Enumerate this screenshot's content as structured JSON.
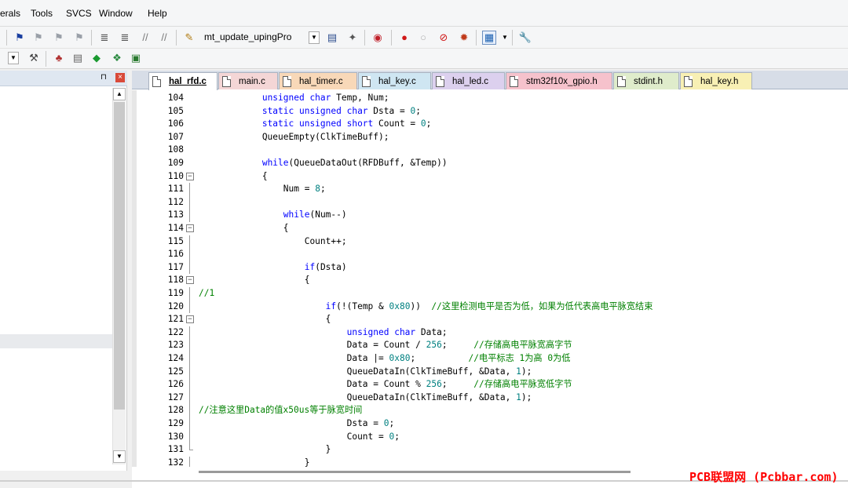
{
  "menu": [
    "erals",
    "Tools",
    "SVCS",
    "Window",
    "Help"
  ],
  "toolbar": {
    "target_name": "mt_update_upingPro"
  },
  "tabs": [
    {
      "label": "hal_rfd.c",
      "color": "#ffffff",
      "active": true
    },
    {
      "label": "main.c",
      "color": "#f4d6d6"
    },
    {
      "label": "hal_timer.c",
      "color": "#f8d8b8"
    },
    {
      "label": "hal_key.c",
      "color": "#cfe6f2"
    },
    {
      "label": "hal_led.c",
      "color": "#dcd0ee"
    },
    {
      "label": "stm32f10x_gpio.h",
      "color": "#f6c2cc"
    },
    {
      "label": "stdint.h",
      "color": "#dfeccb"
    },
    {
      "label": "hal_key.h",
      "color": "#f8f0b4"
    }
  ],
  "code_lines": [
    {
      "n": "104",
      "fold": "",
      "tokens": [
        {
          "t": "            "
        },
        {
          "k": "kw",
          "t": "unsigned char"
        },
        {
          "t": " Temp, Num;"
        }
      ]
    },
    {
      "n": "105",
      "fold": "",
      "tokens": [
        {
          "t": "            "
        },
        {
          "k": "kw",
          "t": "static unsigned char"
        },
        {
          "t": " Dsta = "
        },
        {
          "k": "num",
          "t": "0"
        },
        {
          "t": ";"
        }
      ]
    },
    {
      "n": "106",
      "fold": "",
      "tokens": [
        {
          "t": "            "
        },
        {
          "k": "kw",
          "t": "static unsigned short"
        },
        {
          "t": " Count = "
        },
        {
          "k": "num",
          "t": "0"
        },
        {
          "t": ";"
        }
      ]
    },
    {
      "n": "107",
      "fold": "",
      "tokens": [
        {
          "t": "            QueueEmpty(ClkTimeBuff);"
        }
      ]
    },
    {
      "n": "108",
      "fold": "",
      "tokens": []
    },
    {
      "n": "109",
      "fold": "",
      "tokens": [
        {
          "t": "            "
        },
        {
          "k": "kw",
          "t": "while"
        },
        {
          "t": "(QueueDataOut(RFDBuff, &Temp))"
        }
      ]
    },
    {
      "n": "110",
      "fold": "box",
      "tokens": [
        {
          "t": "            {"
        }
      ]
    },
    {
      "n": "111",
      "fold": "line",
      "tokens": [
        {
          "t": "                Num = "
        },
        {
          "k": "num",
          "t": "8"
        },
        {
          "t": ";"
        }
      ]
    },
    {
      "n": "112",
      "fold": "line",
      "tokens": []
    },
    {
      "n": "113",
      "fold": "line",
      "tokens": [
        {
          "t": "                "
        },
        {
          "k": "kw",
          "t": "while"
        },
        {
          "t": "(Num--)"
        }
      ]
    },
    {
      "n": "114",
      "fold": "box",
      "tokens": [
        {
          "t": "                {"
        }
      ]
    },
    {
      "n": "115",
      "fold": "line",
      "tokens": [
        {
          "t": "                    Count++;"
        }
      ]
    },
    {
      "n": "116",
      "fold": "line",
      "tokens": []
    },
    {
      "n": "117",
      "fold": "line",
      "tokens": [
        {
          "t": "                    "
        },
        {
          "k": "kw",
          "t": "if"
        },
        {
          "t": "(Dsta)"
        }
      ]
    },
    {
      "n": "118",
      "fold": "box",
      "tokens": [
        {
          "t": "                    {"
        }
      ]
    },
    {
      "n": "119",
      "fold": "line",
      "tokens": [
        {
          "k": "cm",
          "t": "//1"
        }
      ]
    },
    {
      "n": "120",
      "fold": "line",
      "tokens": [
        {
          "t": "                        "
        },
        {
          "k": "kw",
          "t": "if"
        },
        {
          "t": "(!(Temp & "
        },
        {
          "k": "num",
          "t": "0x80"
        },
        {
          "t": "))  "
        },
        {
          "k": "cm",
          "t": "//这里检测电平是否为低，如果为低代表高电平脉宽结束"
        }
      ]
    },
    {
      "n": "121",
      "fold": "box",
      "tokens": [
        {
          "t": "                        {"
        }
      ]
    },
    {
      "n": "122",
      "fold": "line",
      "tokens": [
        {
          "t": "                            "
        },
        {
          "k": "kw",
          "t": "unsigned char"
        },
        {
          "t": " Data;"
        }
      ]
    },
    {
      "n": "123",
      "fold": "line",
      "tokens": [
        {
          "t": "                            Data = Count / "
        },
        {
          "k": "num",
          "t": "256"
        },
        {
          "t": ";     "
        },
        {
          "k": "cm",
          "t": "//存储高电平脉宽高字节"
        }
      ]
    },
    {
      "n": "124",
      "fold": "line",
      "tokens": [
        {
          "t": "                            Data |= "
        },
        {
          "k": "num",
          "t": "0x80"
        },
        {
          "t": ";          "
        },
        {
          "k": "cm",
          "t": "//电平标志 1为高 0为低"
        }
      ]
    },
    {
      "n": "125",
      "fold": "line",
      "tokens": [
        {
          "t": "                            QueueDataIn(ClkTimeBuff, &Data, "
        },
        {
          "k": "num",
          "t": "1"
        },
        {
          "t": ");"
        }
      ]
    },
    {
      "n": "126",
      "fold": "line",
      "tokens": [
        {
          "t": "                            Data = Count % "
        },
        {
          "k": "num",
          "t": "256"
        },
        {
          "t": ";     "
        },
        {
          "k": "cm",
          "t": "//存储高电平脉宽低字节"
        }
      ]
    },
    {
      "n": "127",
      "fold": "line",
      "tokens": [
        {
          "t": "                            QueueDataIn(ClkTimeBuff, &Data, "
        },
        {
          "k": "num",
          "t": "1"
        },
        {
          "t": ");"
        }
      ]
    },
    {
      "n": "128",
      "fold": "line",
      "tokens": [
        {
          "k": "cm",
          "t": "//注意这里Data的值x50us等于脉宽时间"
        }
      ]
    },
    {
      "n": "129",
      "fold": "line",
      "tokens": [
        {
          "t": "                            Dsta = "
        },
        {
          "k": "num",
          "t": "0"
        },
        {
          "t": ";"
        }
      ]
    },
    {
      "n": "130",
      "fold": "line",
      "tokens": [
        {
          "t": "                            Count = "
        },
        {
          "k": "num",
          "t": "0"
        },
        {
          "t": ";"
        }
      ]
    },
    {
      "n": "131",
      "fold": "end",
      "tokens": [
        {
          "t": "                        }"
        }
      ]
    },
    {
      "n": "132",
      "fold": "line",
      "tokens": [
        {
          "t": "                    }"
        }
      ]
    }
  ],
  "watermark": "PCB联盟网 (Pcbbar.com)"
}
